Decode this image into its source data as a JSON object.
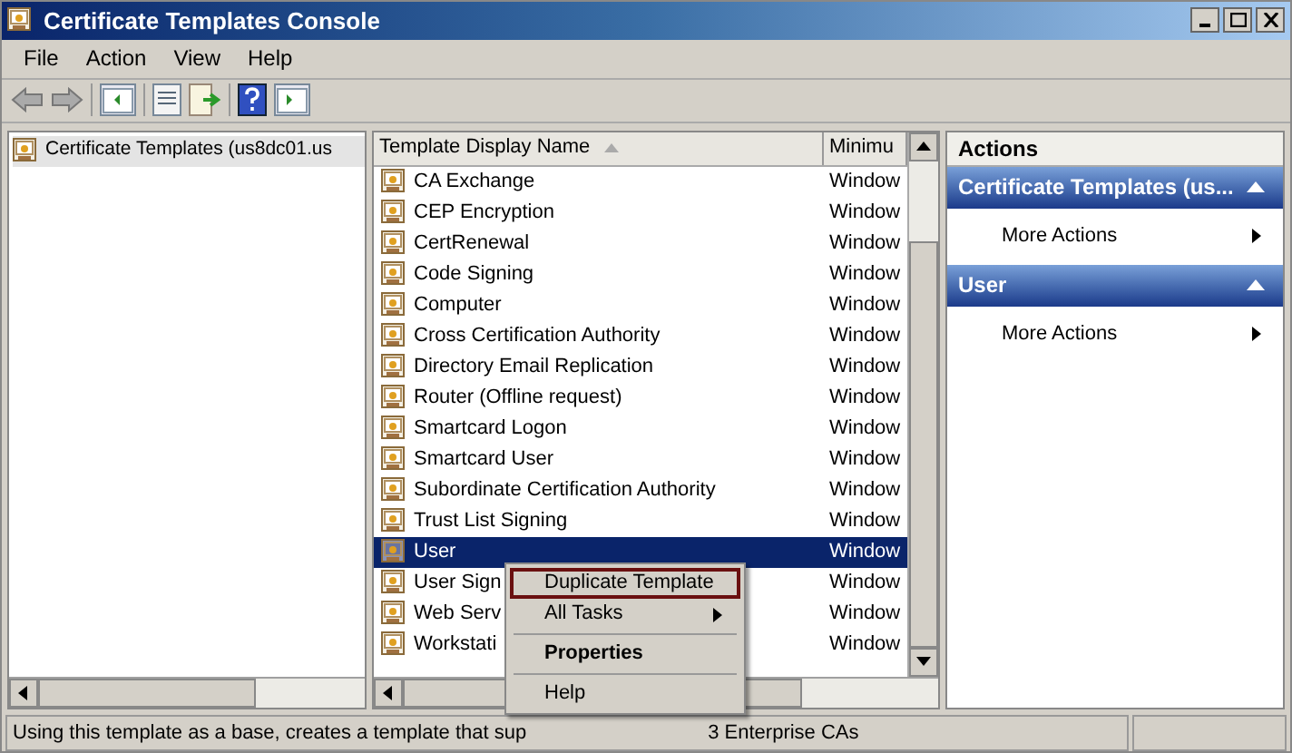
{
  "window": {
    "title": "Certificate Templates Console"
  },
  "menu_bar": [
    {
      "label": "File"
    },
    {
      "label": "Action"
    },
    {
      "label": "View"
    },
    {
      "label": "Help"
    }
  ],
  "tree": [
    {
      "label": "Certificate Templates (us8dc01.us",
      "selected": true
    }
  ],
  "table": {
    "columns": [
      {
        "label": "Template Display Name",
        "sorted": true
      },
      {
        "label": "Minimu",
        "sorted": false
      }
    ],
    "rows": [
      {
        "name": "CA Exchange",
        "column_2": "Window",
        "selected": false
      },
      {
        "name": "CEP Encryption",
        "column_2": "Window",
        "selected": false
      },
      {
        "name": "CertRenewal",
        "column_2": "Window",
        "selected": false
      },
      {
        "name": "Code Signing",
        "column_2": "Window",
        "selected": false
      },
      {
        "name": "Computer",
        "column_2": "Window",
        "selected": false
      },
      {
        "name": "Cross Certification Authority",
        "column_2": "Window",
        "selected": false
      },
      {
        "name": "Directory Email Replication",
        "column_2": "Window",
        "selected": false
      },
      {
        "name": "Router (Offline request)",
        "column_2": "Window",
        "selected": false
      },
      {
        "name": "Smartcard Logon",
        "column_2": "Window",
        "selected": false
      },
      {
        "name": "Smartcard User",
        "column_2": "Window",
        "selected": false
      },
      {
        "name": "Subordinate Certification Authority",
        "column_2": "Window",
        "selected": false
      },
      {
        "name": "Trust List Signing",
        "column_2": "Window",
        "selected": false
      },
      {
        "name": "User",
        "column_2": "Window",
        "selected": true
      },
      {
        "name": "User Sign",
        "column_2": "Window",
        "selected": false
      },
      {
        "name": "Web Serv",
        "column_2": "Window",
        "selected": false
      },
      {
        "name": "Workstati",
        "column_2": "Window",
        "selected": false
      }
    ]
  },
  "actions": {
    "title": "Actions",
    "sections": [
      {
        "title": "Certificate Templates (us...",
        "expanded": true,
        "items": [
          {
            "label": "More Actions"
          }
        ]
      },
      {
        "title": "User",
        "expanded": true,
        "items": [
          {
            "label": "More Actions"
          }
        ]
      }
    ]
  },
  "context_menu": [
    {
      "kind": "item",
      "label": "Duplicate Template",
      "selected": true,
      "bold": false,
      "submenu": false
    },
    {
      "kind": "item",
      "label": "All Tasks",
      "selected": false,
      "bold": false,
      "submenu": true
    },
    {
      "kind": "separator"
    },
    {
      "kind": "item",
      "label": "Properties",
      "selected": false,
      "bold": true,
      "submenu": false
    },
    {
      "kind": "separator"
    },
    {
      "kind": "item",
      "label": "Help",
      "selected": false,
      "bold": false,
      "submenu": false
    }
  ],
  "status_bar": {
    "text_before": "Using this template as a base, creates a template that sup",
    "text_after": "3 Enterprise CAs"
  }
}
